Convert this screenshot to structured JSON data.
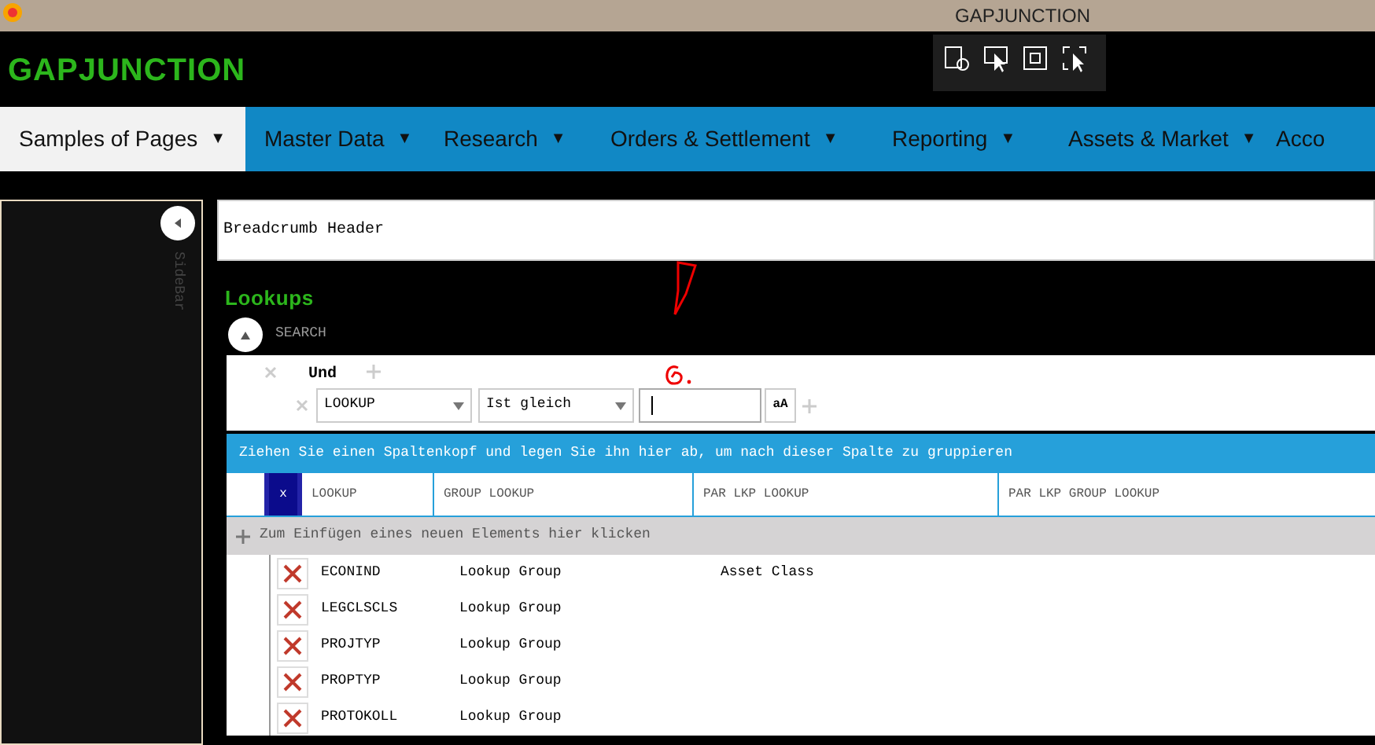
{
  "window": {
    "title": "GAPJUNCTION"
  },
  "app": {
    "logo": "GAPJUNCTION"
  },
  "nav": [
    {
      "label": "Samples of Pages",
      "caret": "▼",
      "selected": true
    },
    {
      "label": "Master Data",
      "caret": "▼",
      "selected": false
    },
    {
      "label": "Research",
      "caret": "▼",
      "selected": false
    },
    {
      "label": "Orders & Settlement",
      "caret": "▼",
      "selected": false
    },
    {
      "label": "Reporting",
      "caret": "▼",
      "selected": false
    },
    {
      "label": "Assets & Market",
      "caret": "▼",
      "selected": false
    },
    {
      "label": "Acco",
      "selected": false
    }
  ],
  "sidebar": {
    "label": "SideBar"
  },
  "breadcrumb": "Breadcrumb Header",
  "page_title": "Lookups",
  "search": {
    "label": "SEARCH",
    "operator": "Und",
    "field": "LOOKUP",
    "condition": "Ist gleich",
    "case_button": "aA"
  },
  "grid": {
    "group_hint": "Ziehen Sie einen Spaltenkopf und legen Sie ihn hier ab, um nach dieser Spalte zu gruppieren",
    "select_all": "x",
    "columns": [
      "LOOKUP",
      "GROUP LOOKUP",
      "PAR LKP LOOKUP",
      "PAR LKP GROUP LOOKUP"
    ],
    "new_row": "Zum Einfügen eines neuen Elements hier klicken",
    "rows": [
      {
        "cells": [
          "ECONIND",
          "Lookup Group",
          "Asset Class",
          ""
        ]
      },
      {
        "cells": [
          "LEGCLSCLS",
          "Lookup Group",
          "",
          ""
        ]
      },
      {
        "cells": [
          "PROJTYP",
          "Lookup Group",
          "",
          ""
        ]
      },
      {
        "cells": [
          "PROPTYP",
          "Lookup Group",
          "",
          ""
        ]
      },
      {
        "cells": [
          "PROTOKOLL",
          "Lookup Group",
          "",
          ""
        ]
      }
    ]
  }
}
